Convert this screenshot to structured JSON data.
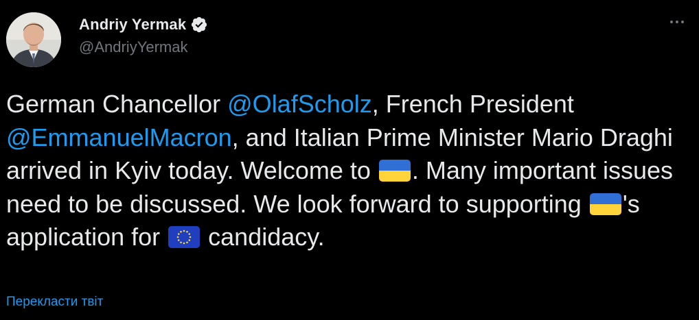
{
  "author": {
    "display_name": "Andriy Yermak",
    "handle": "@AndriyYermak",
    "verified": true
  },
  "tweet": {
    "seg1": "German Chancellor ",
    "mention1": "@OlafScholz",
    "seg2": ", French President ",
    "mention2": "@EmmanuelMacron",
    "seg3": ", and Italian Prime Minister Mario Draghi arrived in Kyiv today. Welcome to ",
    "seg4": ".  Many important issues need to be discussed. We look forward to supporting ",
    "seg5": "'s application for ",
    "seg6": " candidacy."
  },
  "icons": {
    "verified": "verified-badge-icon",
    "more": "more-options-icon",
    "flag1": "ukraine-flag-icon",
    "flag2": "ukraine-flag-icon",
    "flag3": "eu-flag-icon"
  },
  "translate_label": "Перекласти твіт",
  "colors": {
    "background": "#000000",
    "text": "#e7e9ea",
    "secondary": "#71767b",
    "link": "#1d9bf0"
  }
}
